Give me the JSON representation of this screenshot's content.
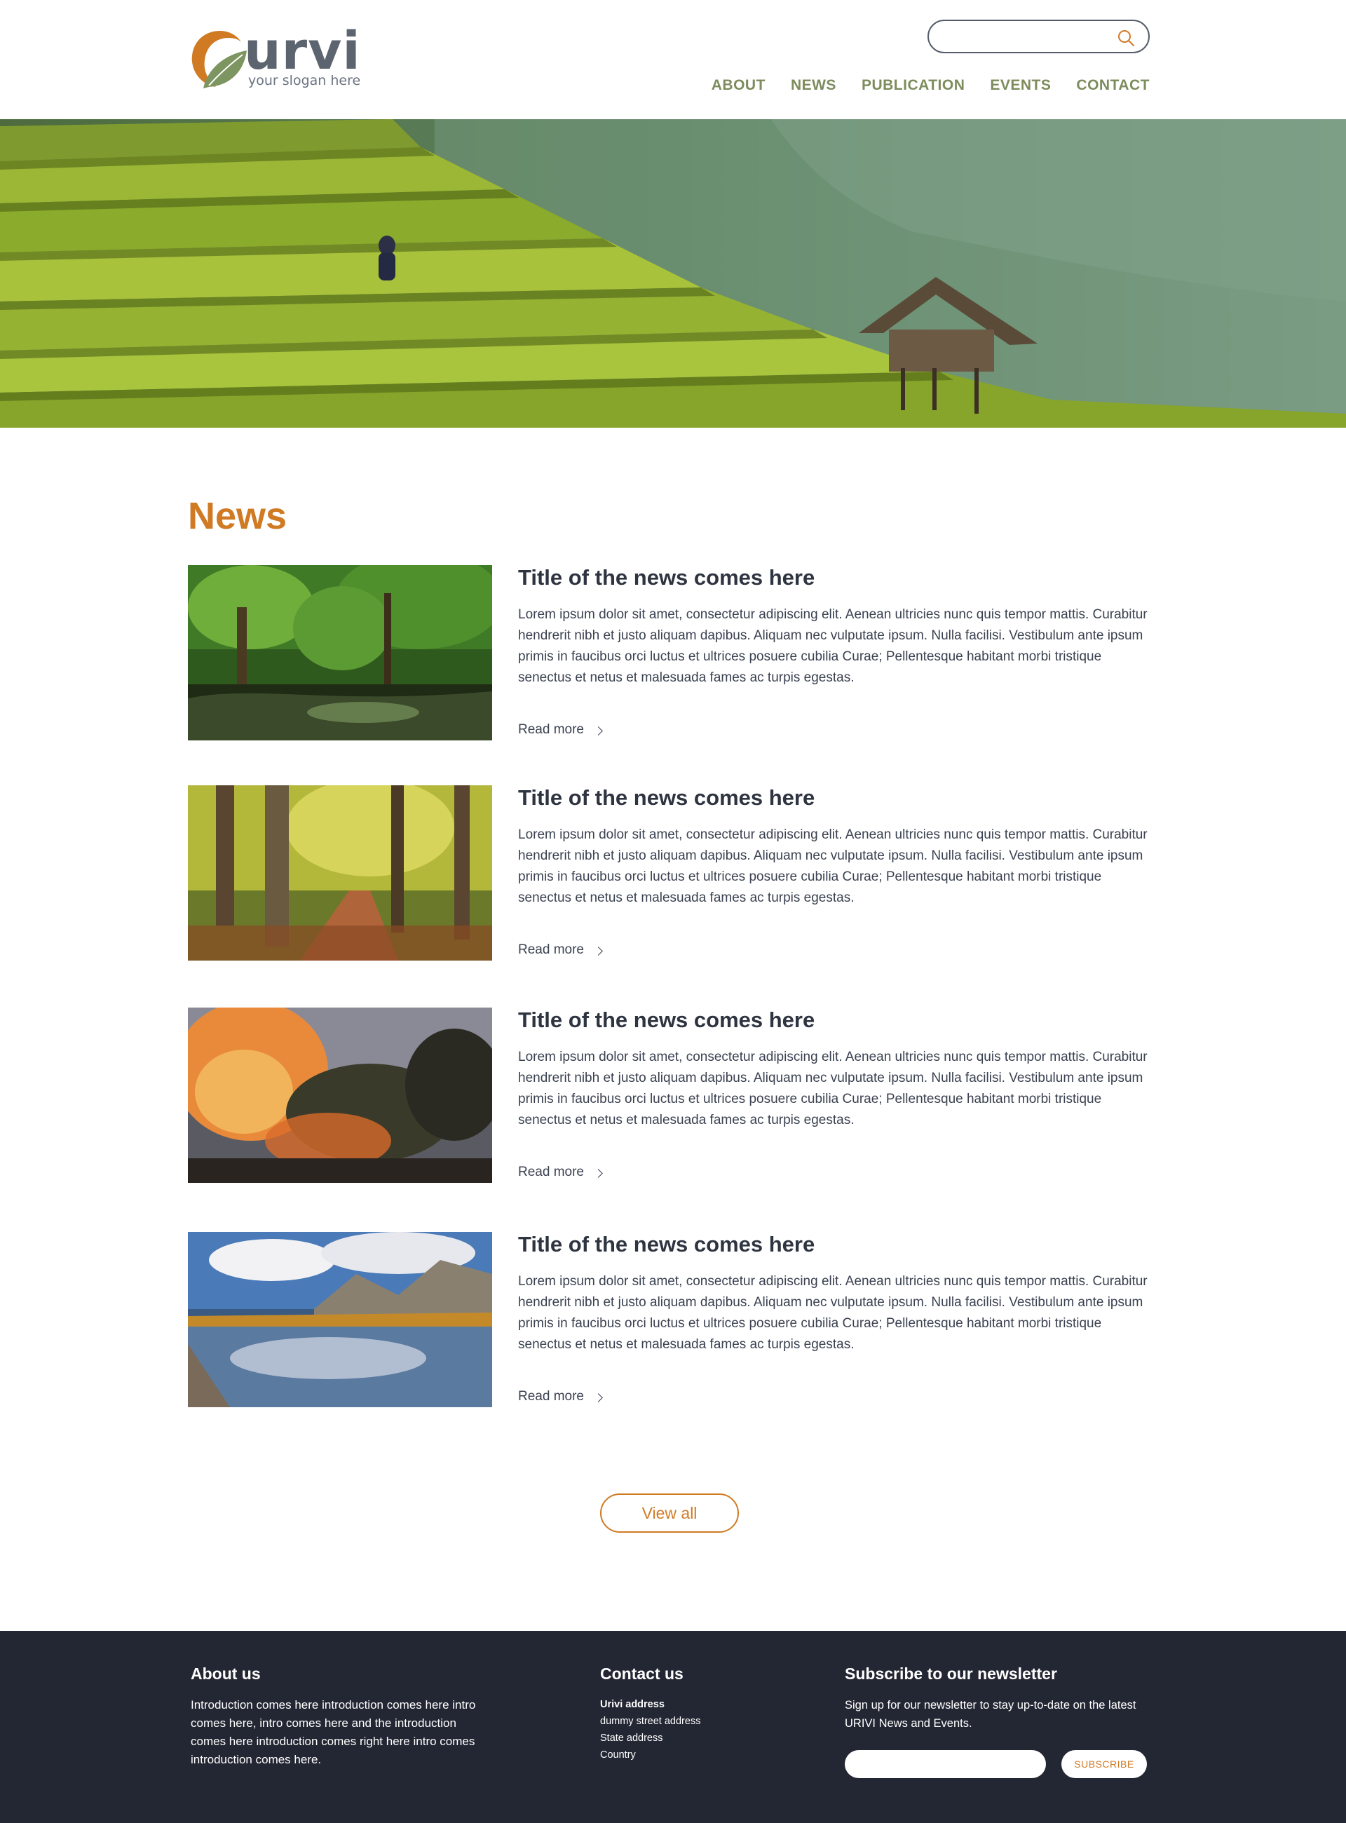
{
  "brand": {
    "name": "urvi",
    "slogan": "your slogan here",
    "colors": {
      "accent": "#d07a24",
      "nav": "#7c8c5c",
      "footer_bg": "#232733",
      "logo_green": "#7d9560"
    }
  },
  "search": {
    "placeholder": "",
    "icon": "search-icon"
  },
  "nav": {
    "items": [
      {
        "label": "ABOUT"
      },
      {
        "label": "NEWS"
      },
      {
        "label": "PUBLICATION"
      },
      {
        "label": "EVENTS"
      },
      {
        "label": "CONTACT"
      }
    ]
  },
  "hero": {
    "image": "rice-terraces-with-hut"
  },
  "news": {
    "heading": "News",
    "items": [
      {
        "image": "tropical-forest-river",
        "title": "Title of the news comes here",
        "body": "Lorem ipsum dolor sit amet, consectetur adipiscing elit. Aenean ultricies nunc quis tempor mattis. Curabitur hendrerit nibh et justo aliquam dapibus. Aliquam nec vulputate ipsum. Nulla facilisi. Vestibulum ante ipsum primis in faucibus orci luctus et ultrices posuere cubilia Curae; Pellentesque habitant morbi tristique senectus et netus et malesuada fames ac turpis egestas.",
        "read_more": "Read more"
      },
      {
        "image": "autumn-forest-path",
        "title": "Title of the news comes here",
        "body": "Lorem ipsum dolor sit amet, consectetur adipiscing elit. Aenean ultricies nunc quis tempor mattis. Curabitur hendrerit nibh et justo aliquam dapibus. Aliquam nec vulputate ipsum. Nulla facilisi. Vestibulum ante ipsum primis in faucibus orci luctus et ultrices posuere cubilia Curae; Pellentesque habitant morbi tristique senectus et netus et malesuada fames ac turpis egestas.",
        "read_more": "Read more"
      },
      {
        "image": "forest-fire",
        "title": "Title of the news comes here",
        "body": "Lorem ipsum dolor sit amet, consectetur adipiscing elit. Aenean ultricies nunc quis tempor mattis. Curabitur hendrerit nibh et justo aliquam dapibus. Aliquam nec vulputate ipsum. Nulla facilisi. Vestibulum ante ipsum primis in faucibus orci luctus et ultrices posuere cubilia Curae; Pellentesque habitant morbi tristique senectus et netus et malesuada fames ac turpis egestas.",
        "read_more": "Read more"
      },
      {
        "image": "mountain-lake-reflection",
        "title": "Title of the news comes here",
        "body": "Lorem ipsum dolor sit amet, consectetur adipiscing elit. Aenean ultricies nunc quis tempor mattis. Curabitur hendrerit nibh et justo aliquam dapibus. Aliquam nec vulputate ipsum. Nulla facilisi. Vestibulum ante ipsum primis in faucibus orci luctus et ultrices posuere cubilia Curae; Pellentesque habitant morbi tristique senectus et netus et malesuada fames ac turpis egestas.",
        "read_more": "Read more"
      }
    ],
    "view_all": "View all"
  },
  "footer": {
    "about": {
      "title": "About us",
      "text": "Introduction comes here introduction comes here intro comes here, intro comes here and the introduction comes here introduction comes right here intro comes introduction comes here."
    },
    "contact": {
      "title": "Contact us",
      "address_name": "Urivi  address",
      "street": "dummy street address",
      "state": "State address",
      "country": "Country"
    },
    "newsletter": {
      "title": "Subscribe to our newsletter",
      "text": "Sign up for our newsletter to stay up-to-date on the latest URIVI News and Events.",
      "input_placeholder": "",
      "button": "SUBSCRIBE"
    }
  }
}
